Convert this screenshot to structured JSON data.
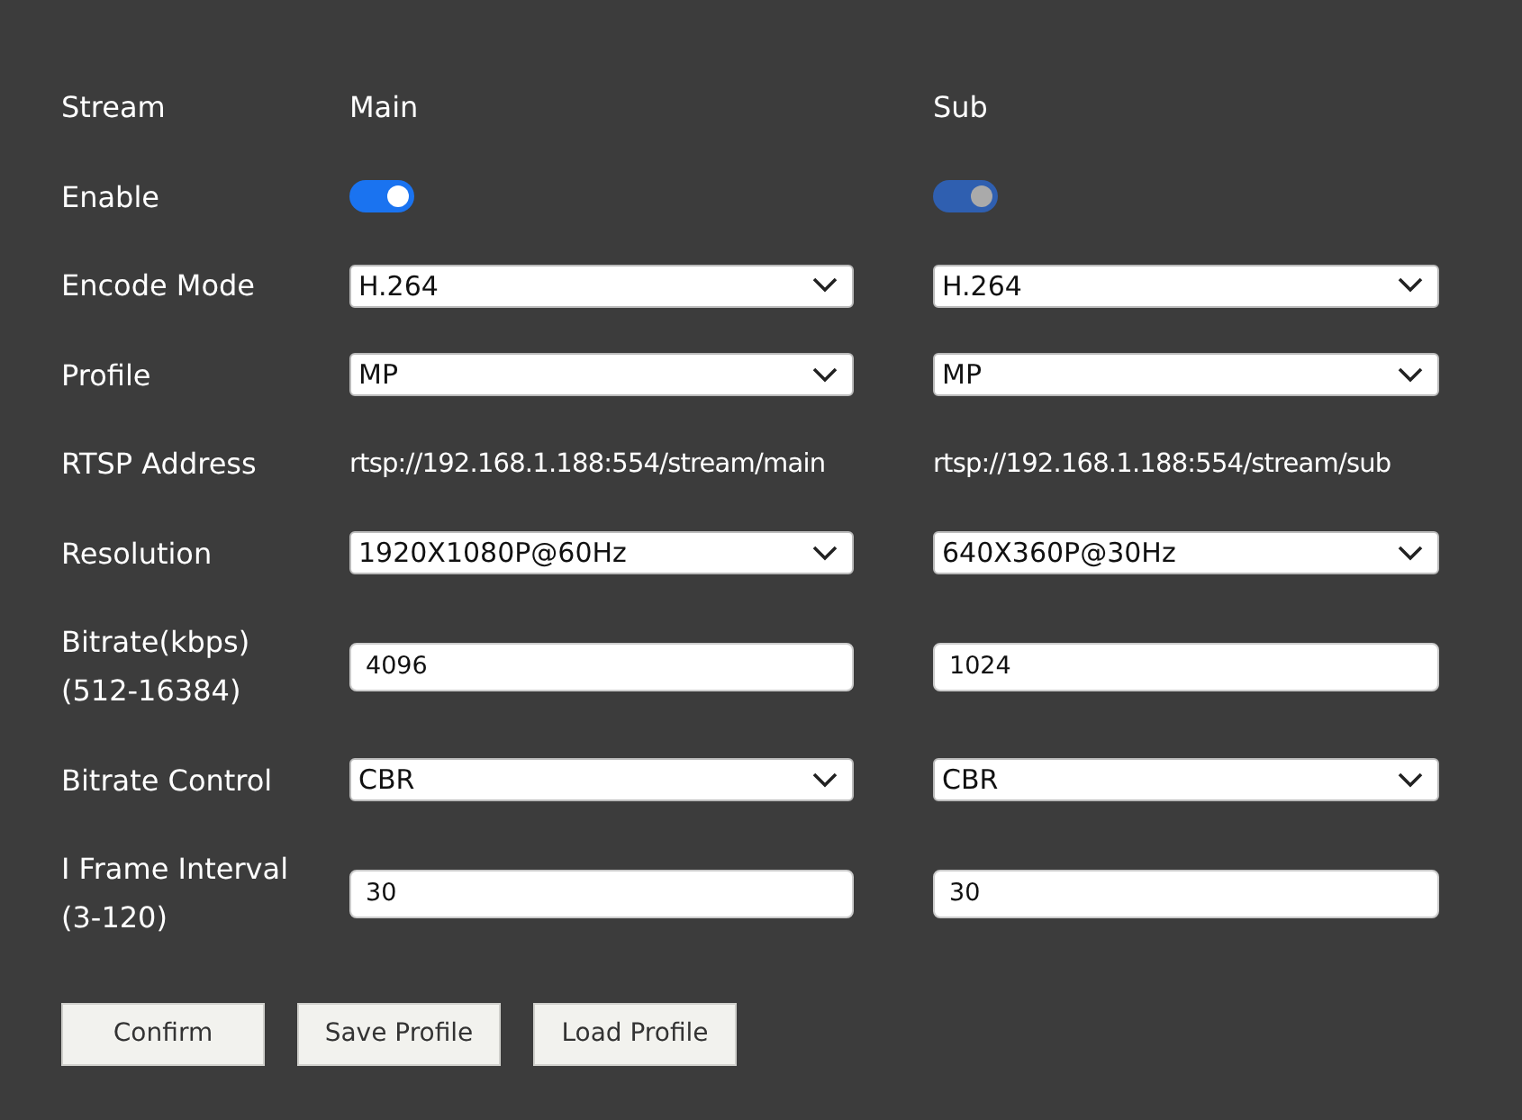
{
  "rows": [
    {
      "kind": "header",
      "label": "Stream",
      "cells": [
        {
          "text": "Main"
        },
        {
          "text": "Sub"
        }
      ]
    },
    {
      "kind": "toggle",
      "label": "Enable",
      "cells": [
        {
          "on": true,
          "disabled": false
        },
        {
          "on": true,
          "disabled": true
        }
      ]
    },
    {
      "kind": "select",
      "label": "Encode Mode",
      "cells": [
        {
          "value": "H.264"
        },
        {
          "value": "H.264"
        }
      ]
    },
    {
      "kind": "select",
      "label": "Profile",
      "cells": [
        {
          "value": "MP"
        },
        {
          "value": "MP"
        }
      ]
    },
    {
      "kind": "text",
      "label": "RTSP Address",
      "cells": [
        {
          "text": "rtsp://192.168.1.188:554/stream/main"
        },
        {
          "text": "rtsp://192.168.1.188:554/stream/sub"
        }
      ]
    },
    {
      "kind": "select",
      "label": "Resolution",
      "cells": [
        {
          "value": "1920X1080P@60Hz"
        },
        {
          "value": "640X360P@30Hz"
        }
      ]
    },
    {
      "kind": "input",
      "label": "Bitrate(kbps)",
      "range": "(512-16384)",
      "cells": [
        {
          "value": "4096"
        },
        {
          "value": "1024"
        }
      ]
    },
    {
      "kind": "select",
      "label": "Bitrate Control",
      "cells": [
        {
          "value": "CBR"
        },
        {
          "value": "CBR"
        }
      ]
    },
    {
      "kind": "input",
      "label": "I Frame Interval",
      "range": "(3-120)",
      "cells": [
        {
          "value": "30"
        },
        {
          "value": "30"
        }
      ]
    }
  ],
  "buttons": [
    "Confirm",
    "Save Profile",
    "Load Profile"
  ]
}
